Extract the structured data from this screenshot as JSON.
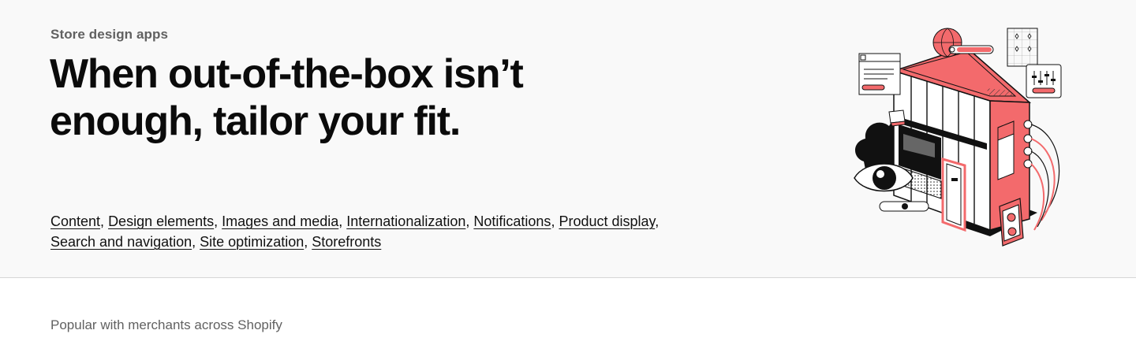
{
  "hero": {
    "eyebrow": "Store design apps",
    "headline": "When out-of-the-box isn’t enough, tailor your fit.",
    "categories": [
      "Content",
      "Design elements",
      "Images and media",
      "Internationalization",
      "Notifications",
      "Product display",
      "Search and navigation",
      "Site optimization",
      "Storefronts"
    ],
    "separator": ", ",
    "trailing_separator": ","
  },
  "section": {
    "popular_label": "Popular with merchants across Shopify"
  },
  "colors": {
    "accent": "#f36a6c",
    "hero_background": "#f9f9f9",
    "muted_text": "#616161"
  }
}
